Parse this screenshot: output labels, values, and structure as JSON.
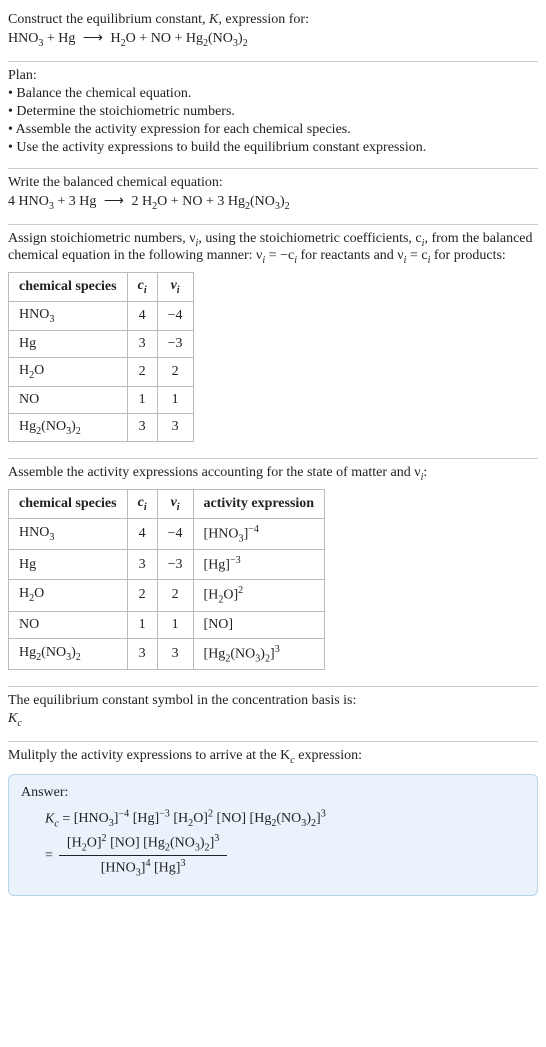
{
  "top": {
    "construct_line": "Construct the equilibrium constant, K, expression for:",
    "eq_left": "HNO",
    "eq_plus1": " + Hg ",
    "eq_arrow": "⟶",
    "eq_right_a": " H",
    "eq_right_b": "O + NO + Hg",
    "eq_right_c": "(NO",
    "eq_right_d": ")"
  },
  "plan": {
    "heading": "Plan:",
    "b1": "• Balance the chemical equation.",
    "b2": "• Determine the stoichiometric numbers.",
    "b3": "• Assemble the activity expression for each chemical species.",
    "b4": "• Use the activity expressions to build the equilibrium constant expression."
  },
  "balanced": {
    "heading": "Write the balanced chemical equation:",
    "c_hno3": "4",
    "c_hg": "3",
    "arrow": "⟶",
    "c_h2o": "2",
    "c_no": "",
    "c_hg2": "3"
  },
  "stoich_intro": {
    "line1": "Assign stoichiometric numbers, ν",
    "line1b": ", using the stoichiometric coefficients, c",
    "line1c": ", from",
    "line2a": "the balanced chemical equation in the following manner: ν",
    "line2b": " = −c",
    "line2c": " for reactants",
    "line3a": "and ν",
    "line3b": " = c",
    "line3c": " for products:"
  },
  "table1": {
    "h_species": "chemical species",
    "h_ci": "c",
    "h_vi": "ν",
    "rows": [
      {
        "sp": "HNO3",
        "ci": "4",
        "vi": "−4"
      },
      {
        "sp": "Hg",
        "ci": "3",
        "vi": "−3"
      },
      {
        "sp": "H2O",
        "ci": "2",
        "vi": "2"
      },
      {
        "sp": "NO",
        "ci": "1",
        "vi": "1"
      },
      {
        "sp": "Hg2(NO3)2",
        "ci": "3",
        "vi": "3"
      }
    ]
  },
  "assemble": {
    "heading": "Assemble the activity expressions accounting for the state of matter and ν",
    "heading_tail": ":"
  },
  "table2": {
    "h_species": "chemical species",
    "h_ci": "c",
    "h_vi": "ν",
    "h_act": "activity expression",
    "rows": [
      {
        "sp": "HNO3",
        "ci": "4",
        "vi": "−4",
        "base": "[HNO3]",
        "exp": "−4"
      },
      {
        "sp": "Hg",
        "ci": "3",
        "vi": "−3",
        "base": "[Hg]",
        "exp": "−3"
      },
      {
        "sp": "H2O",
        "ci": "2",
        "vi": "2",
        "base": "[H2O]",
        "exp": "2"
      },
      {
        "sp": "NO",
        "ci": "1",
        "vi": "1",
        "base": "[NO]",
        "exp": ""
      },
      {
        "sp": "Hg2(NO3)2",
        "ci": "3",
        "vi": "3",
        "base": "[Hg2(NO3)2]",
        "exp": "3"
      }
    ]
  },
  "ksym": {
    "line1": "The equilibrium constant symbol in the concentration basis is:",
    "kc": "K",
    "kc_sub": "c"
  },
  "mult": {
    "line": "Mulitply the activity expressions to arrive at the K",
    "line_tail": " expression:"
  },
  "answer": {
    "label": "Answer:",
    "kc": "K",
    "kc_sub": "c",
    "eq": " = ",
    "terms_line1": [
      {
        "base": "[HNO3]",
        "exp": "−4"
      },
      {
        "base": "[Hg]",
        "exp": "−3"
      },
      {
        "base": "[H2O]",
        "exp": "2"
      },
      {
        "base": "[NO]",
        "exp": ""
      },
      {
        "base": "[Hg2(NO3)2]",
        "exp": "3"
      }
    ],
    "num_terms": [
      {
        "base": "[H2O]",
        "exp": "2"
      },
      {
        "base": "[NO]",
        "exp": ""
      },
      {
        "base": "[Hg2(NO3)2]",
        "exp": "3"
      }
    ],
    "den_terms": [
      {
        "base": "[HNO3]",
        "exp": "4"
      },
      {
        "base": "[Hg]",
        "exp": "3"
      }
    ]
  },
  "chart_data": {
    "type": "table",
    "tables": [
      {
        "columns": [
          "chemical species",
          "c_i",
          "ν_i"
        ],
        "rows": [
          [
            "HNO3",
            4,
            -4
          ],
          [
            "Hg",
            3,
            -3
          ],
          [
            "H2O",
            2,
            2
          ],
          [
            "NO",
            1,
            1
          ],
          [
            "Hg2(NO3)2",
            3,
            3
          ]
        ]
      },
      {
        "columns": [
          "chemical species",
          "c_i",
          "ν_i",
          "activity expression"
        ],
        "rows": [
          [
            "HNO3",
            4,
            -4,
            "[HNO3]^(-4)"
          ],
          [
            "Hg",
            3,
            -3,
            "[Hg]^(-3)"
          ],
          [
            "H2O",
            2,
            2,
            "[H2O]^2"
          ],
          [
            "NO",
            1,
            1,
            "[NO]"
          ],
          [
            "Hg2(NO3)2",
            3,
            3,
            "[Hg2(NO3)2]^3"
          ]
        ]
      }
    ]
  }
}
